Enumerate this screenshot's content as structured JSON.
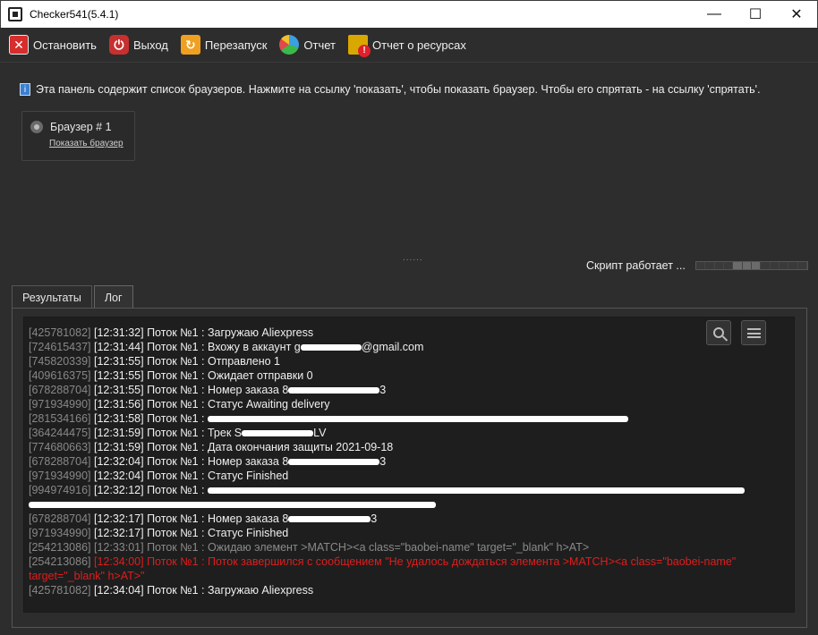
{
  "window": {
    "title": "Checker541(5.4.1)",
    "controls": [
      "—",
      "☐",
      "✕"
    ]
  },
  "toolbar": [
    {
      "label": "Остановить",
      "icon": "stop-icon",
      "glyph": "✕"
    },
    {
      "label": "Выход",
      "icon": "power-icon",
      "glyph": "⏻"
    },
    {
      "label": "Перезапуск",
      "icon": "restart-icon",
      "glyph": "↻"
    },
    {
      "label": "Отчет",
      "icon": "pie-chart-icon",
      "glyph": ""
    },
    {
      "label": "Отчет о ресурсах",
      "icon": "resources-warning-icon",
      "glyph": "!"
    }
  ],
  "panel": {
    "info": "Эта панель содержит список браузеров. Нажмите на ссылку 'показать', чтобы показать браузер. Чтобы его спрятать - на ссылку 'спрятать'.",
    "browser_name": "Браузер # 1",
    "browser_link": "Показать браузер",
    "splitter": "......",
    "script_status": "Скрипт работает ...",
    "progress": {
      "segments": 12,
      "active": [
        4,
        5,
        6
      ]
    }
  },
  "tabs": [
    {
      "label": "Результаты",
      "active": false
    },
    {
      "label": "Лог",
      "active": true
    }
  ],
  "log": [
    {
      "id": "[425781082]",
      "time": "[12:31:32]",
      "text": "Поток №1 : Загружаю Aliexpress"
    },
    {
      "id": "[724615437]",
      "time": "[12:31:44]",
      "text": "Поток №1 : Вхожу в аккаунт g",
      "redact_w": 68,
      "tail": "@gmail.com"
    },
    {
      "id": "[745820339]",
      "time": "[12:31:55]",
      "text": "Поток №1 : Отправлено 1"
    },
    {
      "id": "[409616375]",
      "time": "[12:31:55]",
      "text": "Поток №1 : Ожидает отправки 0"
    },
    {
      "id": "[678288704]",
      "time": "[12:31:55]",
      "text": "Поток №1 : Номер заказа 8",
      "redact_w": 102,
      "tail": "3"
    },
    {
      "id": "[971934990]",
      "time": "[12:31:56]",
      "text": "Поток №1 : Статус Awaiting delivery"
    },
    {
      "id": "[281534166]",
      "time": "[12:31:58]",
      "text": "Поток №1 : ",
      "redact_w": 470,
      "tail": ""
    },
    {
      "id": "[364244475]",
      "time": "[12:31:59]",
      "text": "Поток №1 : Трек S",
      "redact_w": 80,
      "tail": "LV"
    },
    {
      "id": "[774680663]",
      "time": "[12:31:59]",
      "text": "Поток №1 : Дата окончания защиты 2021-09-18"
    },
    {
      "id": "[678288704]",
      "time": "[12:32:04]",
      "text": "Поток №1 : Номер заказа 8",
      "redact_w": 102,
      "tail": "3"
    },
    {
      "id": "[971934990]",
      "time": "[12:32:04]",
      "text": "Поток №1 : Статус Finished"
    },
    {
      "id": "[994974916]",
      "time": "[12:32:12]",
      "text": "Поток №1 : ",
      "redact_w": 600,
      "tail": "",
      "second_redact_w": 455
    },
    {
      "id": "[678288704]",
      "time": "[12:32:17]",
      "text": "Поток №1 : Номер заказа 8",
      "redact_w": 92,
      "tail": "3"
    },
    {
      "id": "[971934990]",
      "time": "[12:32:17]",
      "text": "Поток №1 : Статус Finished"
    },
    {
      "id": "[254213086]",
      "time": "[12:33:01]",
      "text": "Поток №1 : Ожидаю элемент >MATCH><a class=\"baobei-name\" target=\"_blank\" h>AT>",
      "style": "gray"
    },
    {
      "id": "[254213086]",
      "time": "[12:34:00]",
      "text": "Поток №1 : Поток завершился с сообщением \"Не удалось дождаться элемента >MATCH><a class=\"baobei-name\" target=\"_blank\" h>AT>\"",
      "style": "red"
    },
    {
      "id": "[425781082]",
      "time": "[12:34:04]",
      "text": "Поток №1 : Загружаю Aliexpress"
    }
  ]
}
